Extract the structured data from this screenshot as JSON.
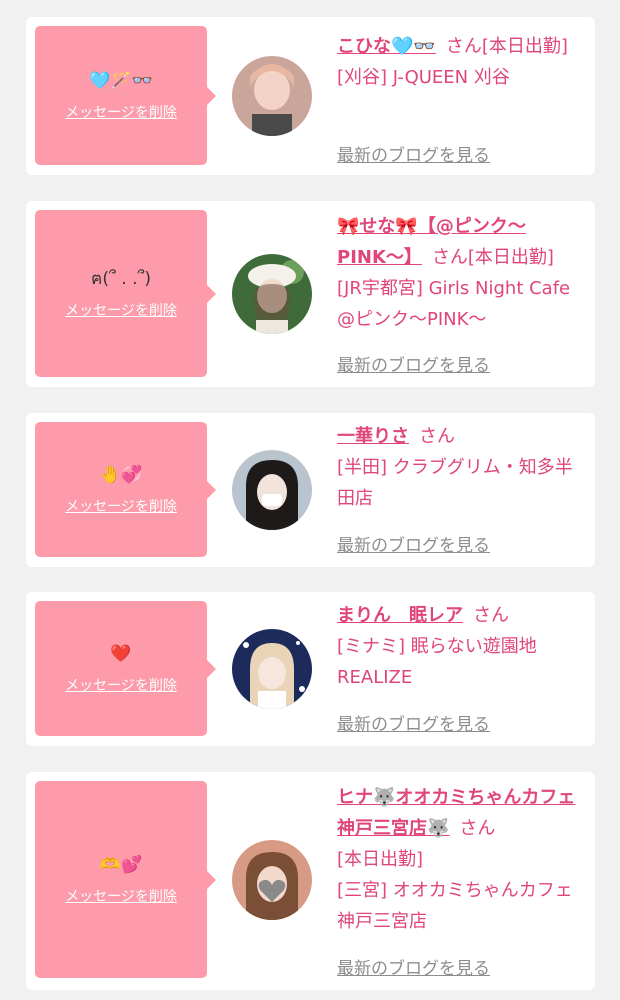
{
  "colors": {
    "background": "#f1f1f1",
    "card": "#ffffff",
    "bubble": "#fd9bab",
    "accent": "#e0457b",
    "muted": "#8d8d8d"
  },
  "delete_label": "メッセージを削除",
  "blog_label": "最新のブログを見る",
  "cards": [
    {
      "message": "🩵🪄👓",
      "name": "こひな🩵👓",
      "san": "さん",
      "status": "[本日出勤]",
      "shop": "[刈谷] J-QUEEN 刈谷",
      "avatar_icon": "person-photo-icon"
    },
    {
      "message": "ฅ(՞ . .՞)",
      "name": "🎀せな🎀【@ピンク〜PINK〜】",
      "san": "さん",
      "status": "[本日出勤]",
      "shop": "[JR宇都宮] Girls Night Cafe @ピンク〜PINK〜",
      "avatar_icon": "person-photo-icon"
    },
    {
      "message": "🤚💞",
      "name": "一華りさ",
      "san": "さん",
      "status": "",
      "shop": "[半田] クラブグリム・知多半田店",
      "avatar_icon": "person-photo-icon"
    },
    {
      "message": "❤️",
      "name": "まりん　眠レア",
      "san": "さん",
      "status": "",
      "shop": "[ミナミ] 眠らない遊園地REALIZE",
      "avatar_icon": "person-photo-icon"
    },
    {
      "message": "🫶💕",
      "name": "ヒナ🐺オオカミちゃんカフェ神戸三宮店🐺",
      "san": "さん",
      "status": "[本日出勤]",
      "shop": "[三宮] オオカミちゃんカフェ神戸三宮店",
      "avatar_icon": "person-photo-icon"
    }
  ]
}
